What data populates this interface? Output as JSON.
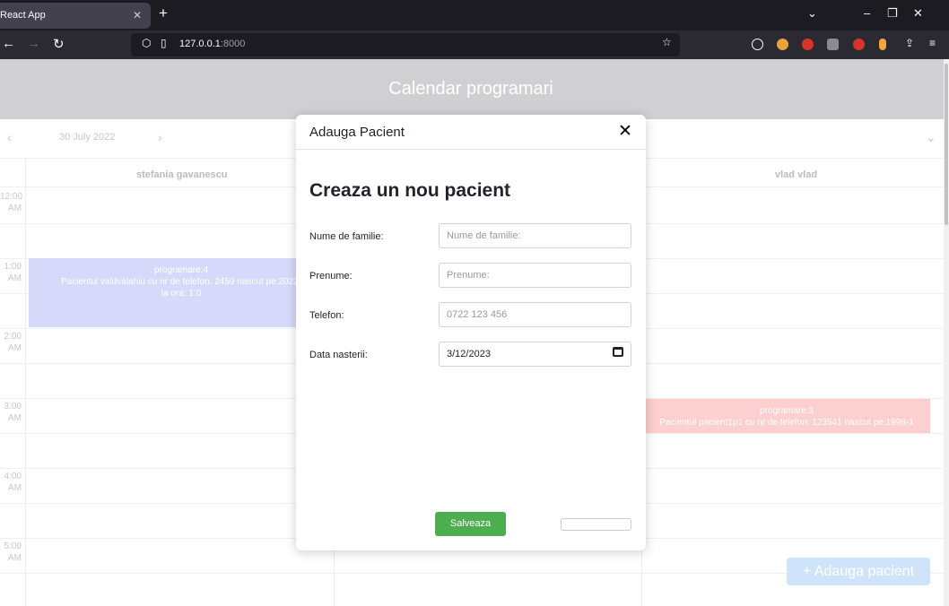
{
  "browser": {
    "tab_title": "React App",
    "url_host": "127.0.0.1",
    "url_port": ":8000"
  },
  "app": {
    "title": "Calendar programari",
    "date": "30 July 2022",
    "columns": [
      "stefania gavanescu",
      "vlad vlad"
    ],
    "times": [
      {
        "h": "12:00",
        "ampm": "AM"
      },
      {
        "h": "1:00",
        "ampm": "AM"
      },
      {
        "h": "2:00",
        "ampm": "AM"
      },
      {
        "h": "3:00",
        "ampm": "AM"
      },
      {
        "h": "4:00",
        "ampm": "AM"
      },
      {
        "h": "5:00",
        "ampm": "AM"
      }
    ],
    "events": [
      {
        "title": "programare:4",
        "line1": "Pacientul valdvalahiu cu nr de telefon: 2459 nascut pe:2022-",
        "line2": "la ora: 1:0"
      },
      {
        "title": "programare:3",
        "line1": "Pacientul pacient1p1 cu nr de telefon: 123541 nascut pe:1998-1"
      }
    ],
    "add_button": "+ Adauga pacient"
  },
  "modal": {
    "title": "Adauga Pacient",
    "heading": "Creaza un nou pacient",
    "fields": [
      {
        "label": "Nume de familie:",
        "placeholder": "Nume de familie:",
        "value": ""
      },
      {
        "label": "Prenume:",
        "placeholder": "Prenume:",
        "value": ""
      },
      {
        "label": "Telefon:",
        "placeholder": "0722 123 456",
        "value": ""
      },
      {
        "label": "Data nasterii:",
        "placeholder": "",
        "value": "3/12/2023"
      }
    ],
    "save_label": "Salveaza"
  }
}
